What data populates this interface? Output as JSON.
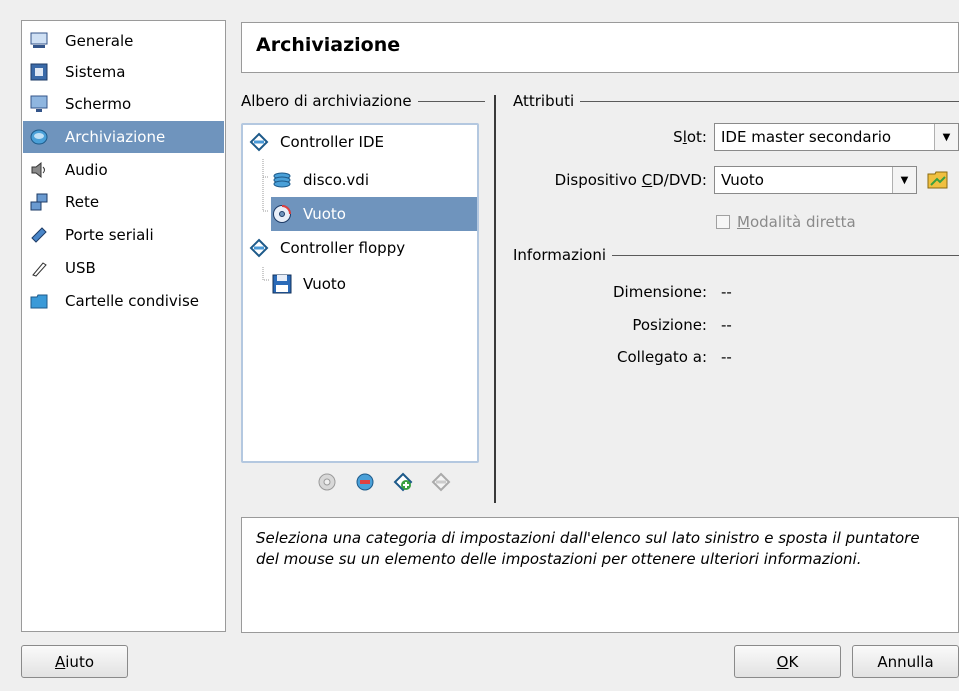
{
  "sidebar": {
    "items": [
      {
        "label": "Generale",
        "icon": "monitor-icon"
      },
      {
        "label": "Sistema",
        "icon": "chip-icon"
      },
      {
        "label": "Schermo",
        "icon": "display-icon"
      },
      {
        "label": "Archiviazione",
        "icon": "storage-icon",
        "selected": true
      },
      {
        "label": "Audio",
        "icon": "speaker-icon"
      },
      {
        "label": "Rete",
        "icon": "network-icon"
      },
      {
        "label": "Porte seriali",
        "icon": "serial-port-icon"
      },
      {
        "label": "USB",
        "icon": "usb-icon"
      },
      {
        "label": "Cartelle condivise",
        "icon": "folder-icon"
      }
    ]
  },
  "page_title": "Archiviazione",
  "tree": {
    "header": "Albero di archiviazione",
    "controller_ide": "Controller IDE",
    "disk": "disco.vdi",
    "cd_empty": "Vuoto",
    "controller_floppy": "Controller floppy",
    "floppy_empty": "Vuoto"
  },
  "attributes": {
    "header": "Attributi",
    "slot_label": "Slot:",
    "slot_value": "IDE master secondario",
    "cd_label": "Dispositivo CD/DVD:",
    "cd_value": "Vuoto",
    "passthrough_label": "Modalità diretta",
    "passthrough_checked": false
  },
  "info": {
    "header": "Informazioni",
    "size_label": "Dimensione:",
    "size_value": "--",
    "location_label": "Posizione:",
    "location_value": "--",
    "attached_label": "Collegato a:",
    "attached_value": "--"
  },
  "description": "Seleziona una categoria di impostazioni dall'elenco sul lato sinistro e sposta il puntatore del mouse su un elemento delle impostazioni per ottenere ulteriori informazioni.",
  "buttons": {
    "help": "Aiuto",
    "ok": "OK",
    "cancel": "Annulla"
  },
  "colors": {
    "selection": "#6f94bd",
    "tree_border": "#b4c8e0"
  }
}
